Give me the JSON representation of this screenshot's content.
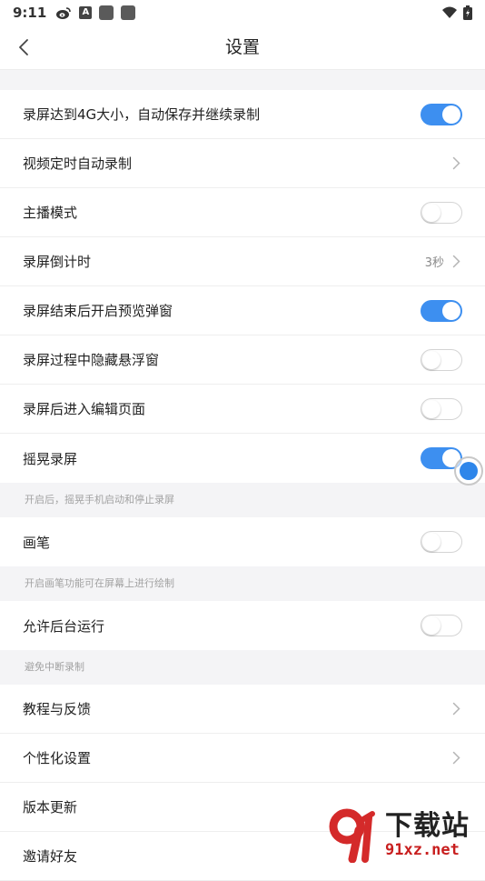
{
  "status_bar": {
    "time": "9:11",
    "icons": [
      "weibo-icon",
      "app-a-icon",
      "notification-box-icon",
      "notification-box-icon",
      "wifi-icon",
      "battery-icon"
    ]
  },
  "header": {
    "title": "设置",
    "back_icon": "chevron-left-icon"
  },
  "settings": [
    {
      "label": "录屏达到4G大小，自动保存并继续录制",
      "type": "toggle",
      "on": true
    },
    {
      "label": "视频定时自动录制",
      "type": "link"
    },
    {
      "label": "主播模式",
      "type": "toggle",
      "on": false
    },
    {
      "label": "录屏倒计时",
      "type": "link",
      "value": "3秒"
    },
    {
      "label": "录屏结束后开启预览弹窗",
      "type": "toggle",
      "on": true
    },
    {
      "label": "录屏过程中隐藏悬浮窗",
      "type": "toggle",
      "on": false
    },
    {
      "label": "录屏后进入编辑页面",
      "type": "toggle",
      "on": false
    },
    {
      "label": "摇晃录屏",
      "type": "toggle",
      "on": true
    }
  ],
  "notes": {
    "shake": "开启后，摇晃手机启动和停止录屏",
    "brush": "开启画笔功能可在屏幕上进行绘制",
    "background": "避免中断录制"
  },
  "brush": {
    "label": "画笔",
    "on": false
  },
  "background_run": {
    "label": "允许后台运行",
    "on": false
  },
  "more": [
    {
      "label": "教程与反馈"
    },
    {
      "label": "个性化设置"
    },
    {
      "label": "版本更新"
    },
    {
      "label": "邀请好友"
    }
  ],
  "watermark": {
    "cn": "下载站",
    "url": "91xz.net"
  },
  "colors": {
    "accent": "#3d8ff0",
    "background": "#f4f4f6",
    "watermark_red": "#c81e1e"
  }
}
